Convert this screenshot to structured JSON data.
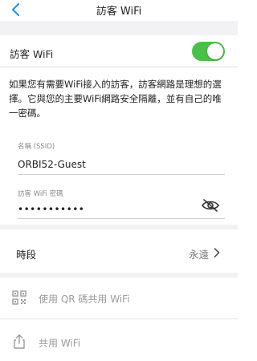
{
  "header": {
    "title": "訪客 WiFi",
    "back_icon": "chevron-left-icon"
  },
  "toggle": {
    "label": "訪客 WiFi",
    "on": true,
    "accent": "#4cbf4a"
  },
  "description": "如果您有需要WiFi接入的訪客，訪客網路是理想的選擇。它與您的主要WiFi網路安全隔離，並有自己的唯一密碼。",
  "ssid_field": {
    "label": "名稱 (SSID)",
    "value": "ORBI52-Guest"
  },
  "password_field": {
    "label": "訪客 WiFi 密碼",
    "value": "•••••••••••",
    "eye_icon": "eye-slash-icon"
  },
  "schedule": {
    "label": "時段",
    "value": "永遠"
  },
  "qr_share": {
    "label": "使用 QR 碼共用 WiFi",
    "icon": "qr-code-icon"
  },
  "share": {
    "label": "共用 WiFi",
    "icon": "share-icon"
  },
  "colors": {
    "background": "#f2f2f4",
    "accent_blue": "#2b8fd6"
  }
}
